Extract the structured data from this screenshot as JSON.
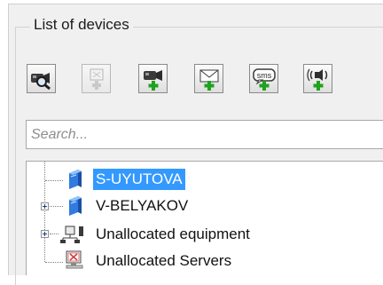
{
  "panel": {
    "group_title": "List of devices"
  },
  "toolbar": {
    "buttons": [
      {
        "icon": "camera-search-icon",
        "enabled": true
      },
      {
        "icon": "add-disabled-icon",
        "enabled": false
      },
      {
        "icon": "add-camera-icon",
        "enabled": true
      },
      {
        "icon": "add-email-icon",
        "enabled": true
      },
      {
        "icon": "add-sms-icon",
        "enabled": true
      },
      {
        "icon": "add-sound-icon",
        "enabled": true
      }
    ],
    "sms_text": "sms"
  },
  "search": {
    "placeholder": "Search...",
    "value": ""
  },
  "tree": {
    "items": [
      {
        "label": "S-UYUTOVA",
        "icon": "server-icon",
        "expandable": false,
        "selected": true
      },
      {
        "label": "V-BELYAKOV",
        "icon": "server-icon",
        "expandable": true,
        "selected": false
      },
      {
        "label": "Unallocated equipment",
        "icon": "equipment-icon",
        "expandable": true,
        "selected": false
      },
      {
        "label": "Unallocated Servers",
        "icon": "monitor-icon",
        "expandable": false,
        "selected": false
      }
    ]
  },
  "colors": {
    "selection": "#3399ff",
    "plus_green": "#1fa31f",
    "panel_bg": "#f0f0f0"
  }
}
